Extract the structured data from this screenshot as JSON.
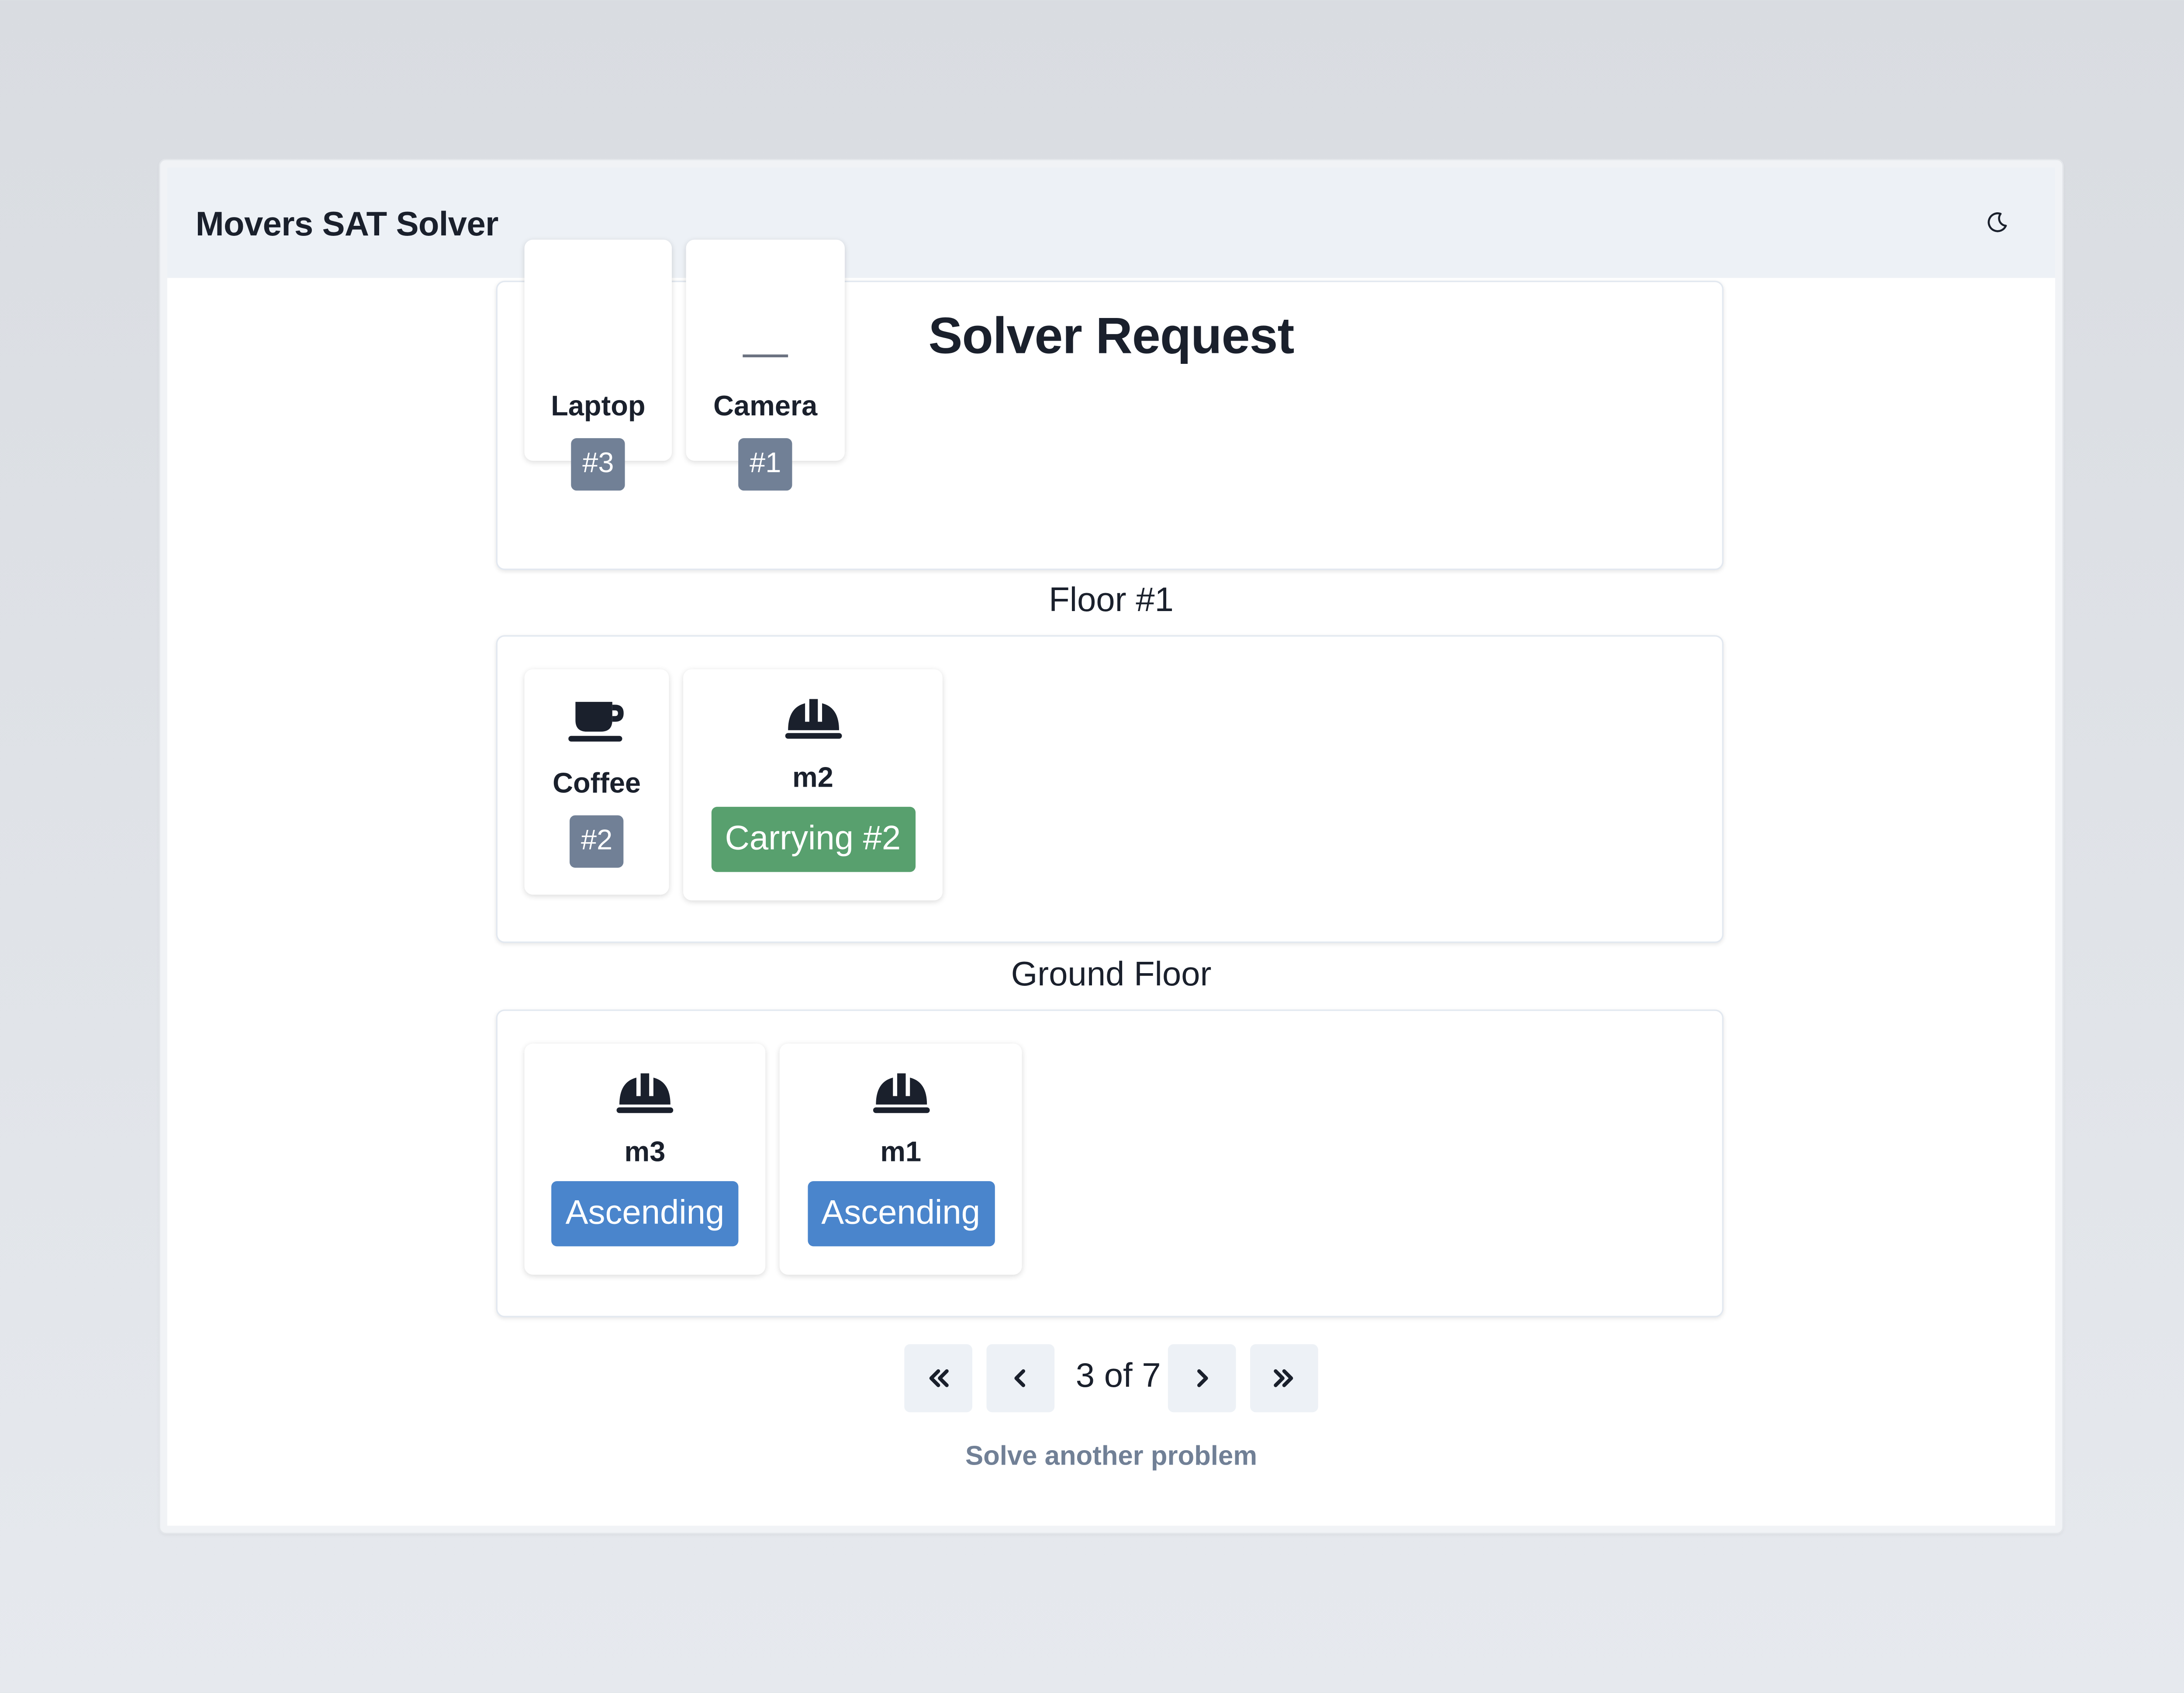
{
  "navbar": {
    "brand": "Movers SAT Solver",
    "theme_toggle_icon": "moon-icon"
  },
  "page": {
    "title": "Solver Request"
  },
  "floors": [
    {
      "label": "",
      "items": [
        {
          "icon": "laptop-icon",
          "name": "Laptop",
          "badge": "#3"
        },
        {
          "icon": "camera-icon",
          "name": "Camera",
          "badge": "#1"
        }
      ]
    },
    {
      "label": "Floor #1",
      "items": [
        {
          "icon": "coffee-icon",
          "name": "Coffee",
          "badge": "#2"
        }
      ],
      "movers": [
        {
          "icon": "hard-hat-icon",
          "name": "m2",
          "status": "Carrying #2",
          "status_color": "#58a06e"
        }
      ]
    },
    {
      "label": "Ground Floor",
      "movers": [
        {
          "icon": "hard-hat-icon",
          "name": "m3",
          "status": "Ascending",
          "status_color": "#4a85cc"
        },
        {
          "icon": "hard-hat-icon",
          "name": "m1",
          "status": "Ascending",
          "status_color": "#4a85cc"
        }
      ]
    }
  ],
  "pagination": {
    "current": "3 of 7",
    "first_icon": "double-chevron-left-icon",
    "prev_icon": "chevron-left-icon",
    "next_icon": "chevron-right-icon",
    "last_icon": "double-chevron-right-icon"
  },
  "footer": {
    "solve_link": "Solve another problem"
  },
  "colors": {
    "accent_blue": "#4a85cc",
    "accent_green": "#58a06e",
    "badge_gray": "#718096",
    "navbar_bg": "#edf1f6"
  }
}
